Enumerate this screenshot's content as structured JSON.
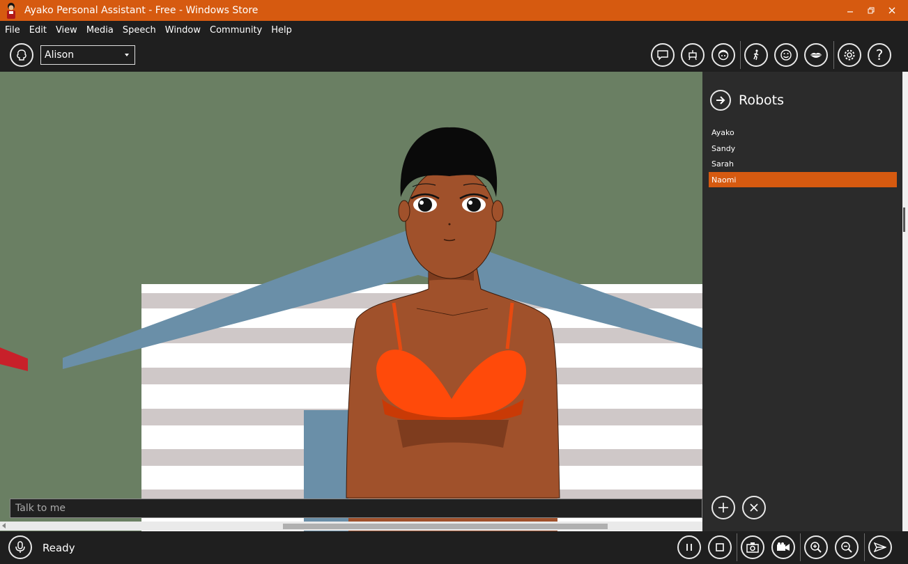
{
  "window": {
    "title": "Ayako Personal Assistant - Free - Windows Store",
    "controls": [
      "minimize-icon",
      "restore-icon",
      "close-icon"
    ]
  },
  "menu": [
    "File",
    "Edit",
    "View",
    "Media",
    "Speech",
    "Window",
    "Community",
    "Help"
  ],
  "toolbar": {
    "character_select": "Alison",
    "buttons": [
      "brain-icon",
      "chat-icon",
      "robot-icon",
      "face-icon",
      "walk-icon",
      "smile-icon",
      "lips-icon",
      "settings-icon",
      "help-icon"
    ]
  },
  "panel": {
    "title": "Robots",
    "items": [
      "Ayako",
      "Sandy",
      "Sarah",
      "Naomi"
    ],
    "selected": "Naomi",
    "actions": [
      "add-icon",
      "remove-icon"
    ]
  },
  "chat": {
    "placeholder": "Talk to me"
  },
  "status": {
    "text": "Ready",
    "buttons": [
      "microphone-icon",
      "pause-icon",
      "stop-icon",
      "camera-icon",
      "video-icon",
      "zoom-in-icon",
      "zoom-out-icon",
      "send-icon"
    ]
  },
  "colors": {
    "accent": "#d65a10",
    "background": "#1f1f1f",
    "panel": "#2b2b2b",
    "scene": "#6a7f63"
  }
}
